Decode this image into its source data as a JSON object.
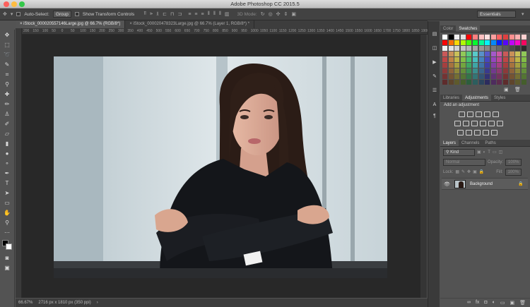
{
  "window": {
    "title": "Adobe Photoshop CC 2015.5"
  },
  "workspace": "Essentials",
  "options_bar": {
    "auto_select_label": "Auto-Select:",
    "auto_select_value": "Group",
    "transform_controls_label": "Show Transform Controls",
    "mode_3d_label": "3D Mode:"
  },
  "documents": {
    "tabs": [
      {
        "label": "iStock_000020557146Large.jpg @ 66.7% (RGB/8*)",
        "active": true
      },
      {
        "label": "iStock_000020478323Large.jpg @ 66.7% (Layer 1, RGB/8*) *",
        "active": false
      }
    ]
  },
  "ruler": {
    "ticks": [
      "200",
      "150",
      "100",
      "50",
      "0",
      "50",
      "100",
      "150",
      "200",
      "250",
      "300",
      "350",
      "400",
      "450",
      "500",
      "550",
      "600",
      "650",
      "700",
      "750",
      "800",
      "850",
      "900",
      "950",
      "1000",
      "1050",
      "1100",
      "1150",
      "1200",
      "1250",
      "1300",
      "1350",
      "1400",
      "1450",
      "1500",
      "1550",
      "1600",
      "1650",
      "1700",
      "1750",
      "1800",
      "1850",
      "1900"
    ]
  },
  "status": {
    "zoom": "66.67%",
    "doc_info": "2716 px x 1810 px (350 ppi)"
  },
  "color_panel": {
    "tabs": [
      "Color",
      "Swatches"
    ],
    "active": "Swatches"
  },
  "adjustments_panel": {
    "tabs": [
      "Libraries",
      "Adjustments",
      "Styles"
    ],
    "active": "Adjustments",
    "hint": "Add an adjustment"
  },
  "layers_panel": {
    "tabs": [
      "Layers",
      "Channels",
      "Paths"
    ],
    "active": "Layers",
    "filter": "Kind",
    "blend_mode": "Normal",
    "opacity_label": "Opacity:",
    "opacity_value": "100%",
    "lock_label": "Lock:",
    "fill_label": "Fill:",
    "fill_value": "100%",
    "layers": [
      {
        "name": "Background",
        "locked": true,
        "visible": true
      }
    ]
  },
  "colors": {
    "accent": "#1473e6",
    "panel": "#535353",
    "bg_dark": "#282828"
  }
}
